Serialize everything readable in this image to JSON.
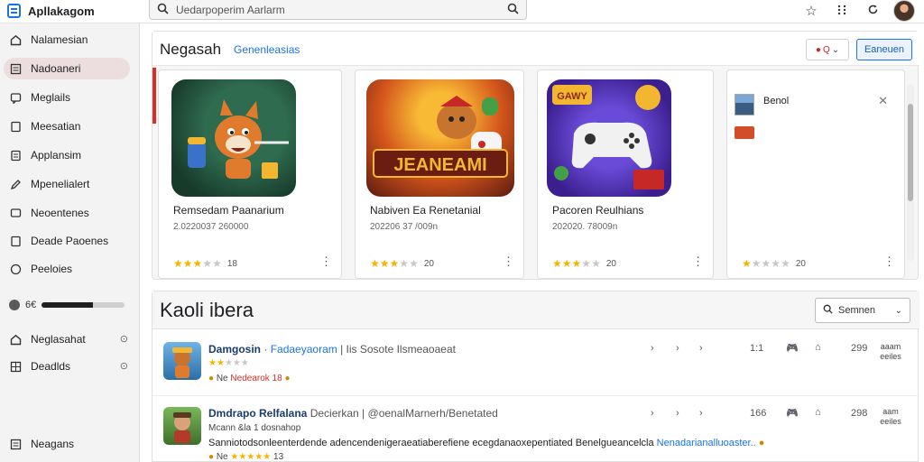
{
  "app": {
    "title": "Apllakagom"
  },
  "search": {
    "value": "Uedarpoperim Aarlarm"
  },
  "sidebar": {
    "items": [
      {
        "label": "Nalamesian"
      },
      {
        "label": "Nadoaneri"
      },
      {
        "label": "Meglails"
      },
      {
        "label": "Meesatian"
      },
      {
        "label": "Applansim"
      },
      {
        "label": "Mpenelialert"
      },
      {
        "label": "Neoentenes"
      },
      {
        "label": "Deade Paoenes"
      },
      {
        "label": "Peeloies"
      }
    ],
    "usage": {
      "label": "6€",
      "fraction": 0.62
    },
    "secondary": [
      {
        "label": "Neglasahat"
      },
      {
        "label": "Deadlds"
      }
    ],
    "footer": {
      "label": "Neagans"
    }
  },
  "featured": {
    "title": "Negasah",
    "link": "Genenleasias",
    "button": "Eaneuen",
    "cards": [
      {
        "name": "Remsedam Paanarium",
        "sub": "2.0220037 260000",
        "rating": 2.5,
        "rating_label": "18"
      },
      {
        "name": "Nabiven Ea Renetanial",
        "sub": "202206 37 /009n",
        "rating": 3,
        "rating_label": "20",
        "art_text": "JEANEAMI"
      },
      {
        "name": "Pacoren Reulhians",
        "sub": "202020. 78009n",
        "rating": 2.5,
        "rating_label": "20",
        "art_text": "GAWY"
      },
      {
        "label": "Benol",
        "rating": 1,
        "rating_label": "20"
      }
    ]
  },
  "list": {
    "title": "Kaoli ibera",
    "sort": "Semnen",
    "rows": [
      {
        "title": "Damgosin",
        "tag": "Fadaeyaoram",
        "extra": "| Iis Sosote Ilsmeaoaeat",
        "line2": "Ne",
        "line2_tag": "Nedearok 18",
        "stat": "1:1",
        "size_num": "299",
        "size_unit": "aaam eeiles",
        "rating": 2
      },
      {
        "title": "Dmdrapo Relfalana",
        "dev": "Decierkan |",
        "tag": "@oenalMarnerh/Benetated",
        "line2": "Mcann &la 1 dosnahop",
        "long": "Sanniotodsonleenterdende adencendenigeraeatiaberefiene ecegdanaoxepentiated Benelgueancelcla",
        "long_tag": "Nenadarianalluoaster..",
        "line3": "Ne",
        "line3_rating": "13",
        "stat": "166",
        "size_num": "298",
        "size_unit": "aam eeiles",
        "rating": 5
      }
    ]
  }
}
